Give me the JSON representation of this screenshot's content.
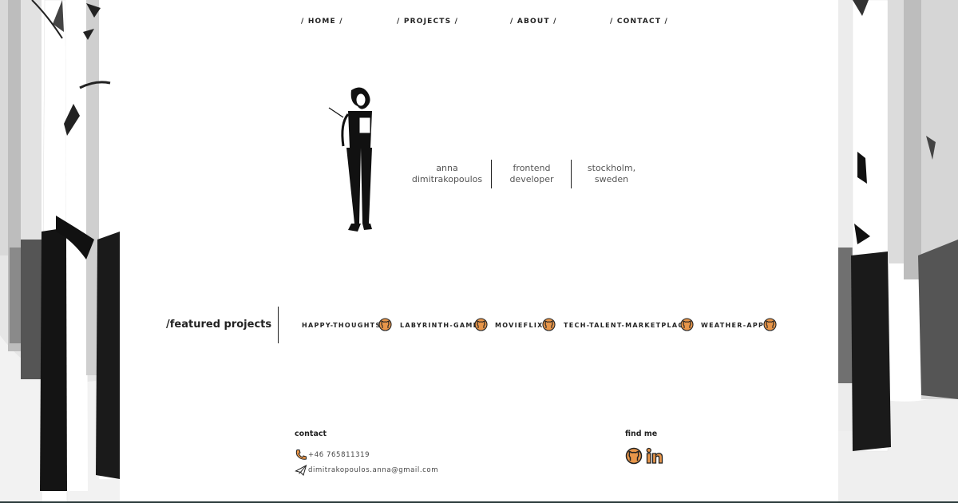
{
  "nav": {
    "items": [
      {
        "label": "/ HOME /"
      },
      {
        "label": "/ PROJECTS /"
      },
      {
        "label": "/ ABOUT /"
      },
      {
        "label": "/ CONTACT /"
      }
    ]
  },
  "hero": {
    "name": [
      "anna",
      "dimitrakopoulos"
    ],
    "role": [
      "frontend",
      "developer"
    ],
    "location": [
      "stockholm,",
      "sweden"
    ]
  },
  "featured": {
    "title": "/featured projects",
    "projects": [
      {
        "label": "HAPPY-THOUGHTS",
        "icon": "github-icon"
      },
      {
        "label": "LABYRINTH-GAME",
        "icon": "github-icon"
      },
      {
        "label": "MOVIEFLIX",
        "icon": "github-icon"
      },
      {
        "label": "TECH-TALENT-MARKETPLACE",
        "icon": "github-icon"
      },
      {
        "label": "WEATHER-APP",
        "icon": "github-icon"
      }
    ]
  },
  "contact": {
    "heading": "contact",
    "phone": "+46 765811319",
    "email": "dimitrakopoulos.anna@gmail.com"
  },
  "find_me": {
    "heading": "find me",
    "links": [
      {
        "icon": "github-icon"
      },
      {
        "icon": "linkedin-icon"
      }
    ]
  },
  "colors": {
    "accent": "#e8964a",
    "text": "#222222",
    "muted": "#555555"
  }
}
